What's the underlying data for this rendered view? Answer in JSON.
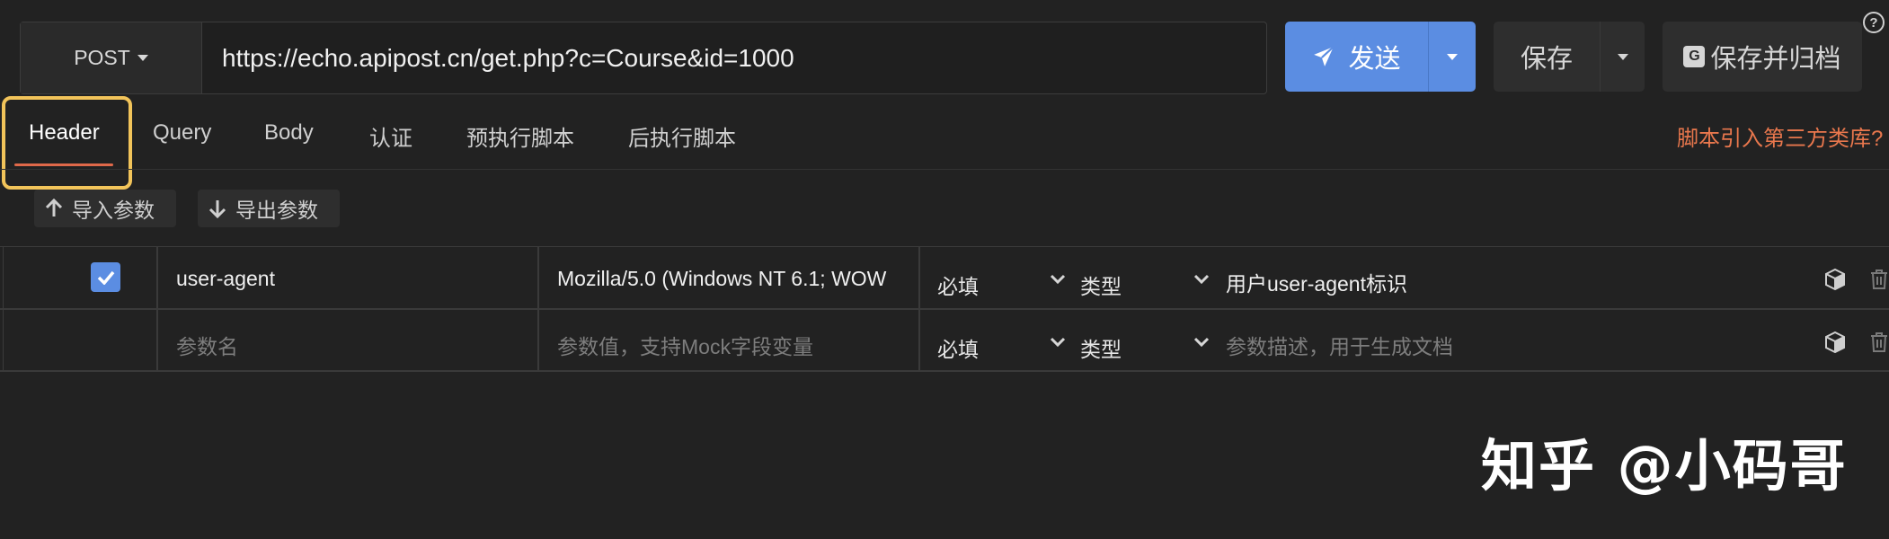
{
  "request": {
    "method": "POST",
    "url": "https://echo.apipost.cn/get.php?c=Course&id=1000"
  },
  "actions": {
    "send_label": "发送",
    "save_label": "保存",
    "save_archive_label": "保存并归档",
    "help": "?"
  },
  "tabs": [
    {
      "label": "Header",
      "active": true
    },
    {
      "label": "Query"
    },
    {
      "label": "Body"
    },
    {
      "label": "认证"
    },
    {
      "label": "预执行脚本"
    },
    {
      "label": "后执行脚本"
    }
  ],
  "third_party_link": "脚本引入第三方类库?",
  "toolbar": {
    "import_label": "导入参数",
    "export_label": "导出参数"
  },
  "params": {
    "rows": [
      {
        "checked": true,
        "name": "user-agent",
        "value": "Mozilla/5.0 (Windows NT 6.1; WOW",
        "required": "必填",
        "type": "类型",
        "description": "用户user-agent标识"
      }
    ],
    "empty_row": {
      "name_placeholder": "参数名",
      "value_placeholder": "参数值，支持Mock字段变量",
      "required": "必填",
      "type": "类型",
      "description_placeholder": "参数描述，用于生成文档"
    }
  },
  "watermark": "知乎 @小码哥",
  "colors": {
    "background": "#222222",
    "primary": "#5b8de2",
    "accent": "#e8774d",
    "highlight": "#f2c45a"
  }
}
